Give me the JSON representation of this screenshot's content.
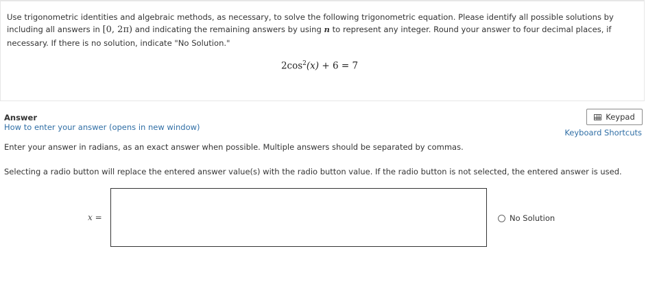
{
  "question": {
    "prompt_part1": "Use trigonometric identities and algebraic methods, as necessary, to solve the following trigonometric equation. Please identify all possible solutions by including all answers in ",
    "interval": "[0, 2π)",
    "prompt_part2": " and indicating the remaining answers by using ",
    "n_symbol": "n",
    "prompt_part3": " to represent any integer. Round your answer to four decimal places, if necessary. If there is no solution, indicate \"No Solution.\"",
    "equation": {
      "coef": "2cos",
      "power": "2",
      "arg": "(x)",
      "rest": " + 6 = 7"
    }
  },
  "answer": {
    "heading": "Answer",
    "how_to_link": "How to enter your answer (opens in new window)",
    "keypad_label": "Keypad",
    "shortcuts_link": "Keyboard Shortcuts",
    "instructions": "Enter your answer in radians, as an exact answer when possible. Multiple answers should be separated by commas.",
    "radio_note": "Selecting a radio button will replace the entered answer value(s) with the radio button value. If the radio button is not selected, the entered answer is used.",
    "variable": "x",
    "equals": " =",
    "input_value": "",
    "no_solution_label": "No Solution",
    "no_solution_selected": false
  },
  "colors": {
    "link": "#2f6ea5",
    "text": "#333333",
    "border": "#e6e6e6"
  }
}
